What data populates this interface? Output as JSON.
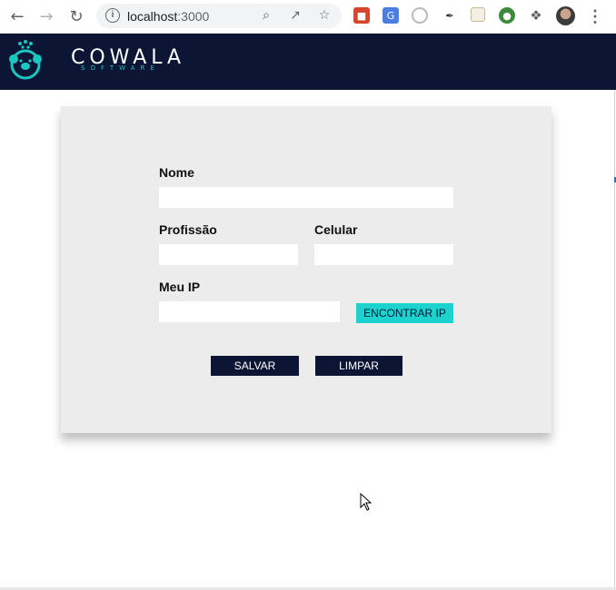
{
  "browser": {
    "url_host": "localhost",
    "url_port": ":3000"
  },
  "header": {
    "brand": "COWALA",
    "brand_sub": "SOFTWARE",
    "bg_color": "#0c1634",
    "accent_color": "#1bc5c0"
  },
  "form": {
    "nome_label": "Nome",
    "nome_value": "",
    "profissao_label": "Profissão",
    "profissao_value": "",
    "celular_label": "Celular",
    "celular_value": "",
    "ip_label": "Meu IP",
    "ip_value": "",
    "find_ip_button": "ENCONTRAR IP",
    "save_button": "SALVAR",
    "clear_button": "LIMPAR"
  }
}
